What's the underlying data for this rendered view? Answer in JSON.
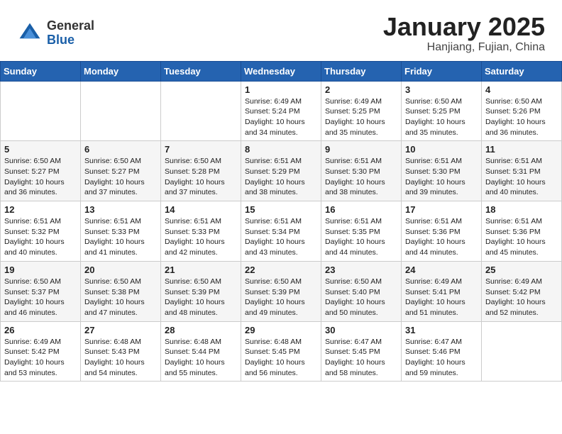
{
  "header": {
    "logo_general": "General",
    "logo_blue": "Blue",
    "month_title": "January 2025",
    "location": "Hanjiang, Fujian, China"
  },
  "weekdays": [
    "Sunday",
    "Monday",
    "Tuesday",
    "Wednesday",
    "Thursday",
    "Friday",
    "Saturday"
  ],
  "weeks": [
    [
      {
        "day": "",
        "info": ""
      },
      {
        "day": "",
        "info": ""
      },
      {
        "day": "",
        "info": ""
      },
      {
        "day": "1",
        "info": "Sunrise: 6:49 AM\nSunset: 5:24 PM\nDaylight: 10 hours\nand 34 minutes."
      },
      {
        "day": "2",
        "info": "Sunrise: 6:49 AM\nSunset: 5:25 PM\nDaylight: 10 hours\nand 35 minutes."
      },
      {
        "day": "3",
        "info": "Sunrise: 6:50 AM\nSunset: 5:25 PM\nDaylight: 10 hours\nand 35 minutes."
      },
      {
        "day": "4",
        "info": "Sunrise: 6:50 AM\nSunset: 5:26 PM\nDaylight: 10 hours\nand 36 minutes."
      }
    ],
    [
      {
        "day": "5",
        "info": "Sunrise: 6:50 AM\nSunset: 5:27 PM\nDaylight: 10 hours\nand 36 minutes."
      },
      {
        "day": "6",
        "info": "Sunrise: 6:50 AM\nSunset: 5:27 PM\nDaylight: 10 hours\nand 37 minutes."
      },
      {
        "day": "7",
        "info": "Sunrise: 6:50 AM\nSunset: 5:28 PM\nDaylight: 10 hours\nand 37 minutes."
      },
      {
        "day": "8",
        "info": "Sunrise: 6:51 AM\nSunset: 5:29 PM\nDaylight: 10 hours\nand 38 minutes."
      },
      {
        "day": "9",
        "info": "Sunrise: 6:51 AM\nSunset: 5:30 PM\nDaylight: 10 hours\nand 38 minutes."
      },
      {
        "day": "10",
        "info": "Sunrise: 6:51 AM\nSunset: 5:30 PM\nDaylight: 10 hours\nand 39 minutes."
      },
      {
        "day": "11",
        "info": "Sunrise: 6:51 AM\nSunset: 5:31 PM\nDaylight: 10 hours\nand 40 minutes."
      }
    ],
    [
      {
        "day": "12",
        "info": "Sunrise: 6:51 AM\nSunset: 5:32 PM\nDaylight: 10 hours\nand 40 minutes."
      },
      {
        "day": "13",
        "info": "Sunrise: 6:51 AM\nSunset: 5:33 PM\nDaylight: 10 hours\nand 41 minutes."
      },
      {
        "day": "14",
        "info": "Sunrise: 6:51 AM\nSunset: 5:33 PM\nDaylight: 10 hours\nand 42 minutes."
      },
      {
        "day": "15",
        "info": "Sunrise: 6:51 AM\nSunset: 5:34 PM\nDaylight: 10 hours\nand 43 minutes."
      },
      {
        "day": "16",
        "info": "Sunrise: 6:51 AM\nSunset: 5:35 PM\nDaylight: 10 hours\nand 44 minutes."
      },
      {
        "day": "17",
        "info": "Sunrise: 6:51 AM\nSunset: 5:36 PM\nDaylight: 10 hours\nand 44 minutes."
      },
      {
        "day": "18",
        "info": "Sunrise: 6:51 AM\nSunset: 5:36 PM\nDaylight: 10 hours\nand 45 minutes."
      }
    ],
    [
      {
        "day": "19",
        "info": "Sunrise: 6:50 AM\nSunset: 5:37 PM\nDaylight: 10 hours\nand 46 minutes."
      },
      {
        "day": "20",
        "info": "Sunrise: 6:50 AM\nSunset: 5:38 PM\nDaylight: 10 hours\nand 47 minutes."
      },
      {
        "day": "21",
        "info": "Sunrise: 6:50 AM\nSunset: 5:39 PM\nDaylight: 10 hours\nand 48 minutes."
      },
      {
        "day": "22",
        "info": "Sunrise: 6:50 AM\nSunset: 5:39 PM\nDaylight: 10 hours\nand 49 minutes."
      },
      {
        "day": "23",
        "info": "Sunrise: 6:50 AM\nSunset: 5:40 PM\nDaylight: 10 hours\nand 50 minutes."
      },
      {
        "day": "24",
        "info": "Sunrise: 6:49 AM\nSunset: 5:41 PM\nDaylight: 10 hours\nand 51 minutes."
      },
      {
        "day": "25",
        "info": "Sunrise: 6:49 AM\nSunset: 5:42 PM\nDaylight: 10 hours\nand 52 minutes."
      }
    ],
    [
      {
        "day": "26",
        "info": "Sunrise: 6:49 AM\nSunset: 5:42 PM\nDaylight: 10 hours\nand 53 minutes."
      },
      {
        "day": "27",
        "info": "Sunrise: 6:48 AM\nSunset: 5:43 PM\nDaylight: 10 hours\nand 54 minutes."
      },
      {
        "day": "28",
        "info": "Sunrise: 6:48 AM\nSunset: 5:44 PM\nDaylight: 10 hours\nand 55 minutes."
      },
      {
        "day": "29",
        "info": "Sunrise: 6:48 AM\nSunset: 5:45 PM\nDaylight: 10 hours\nand 56 minutes."
      },
      {
        "day": "30",
        "info": "Sunrise: 6:47 AM\nSunset: 5:45 PM\nDaylight: 10 hours\nand 58 minutes."
      },
      {
        "day": "31",
        "info": "Sunrise: 6:47 AM\nSunset: 5:46 PM\nDaylight: 10 hours\nand 59 minutes."
      },
      {
        "day": "",
        "info": ""
      }
    ]
  ]
}
